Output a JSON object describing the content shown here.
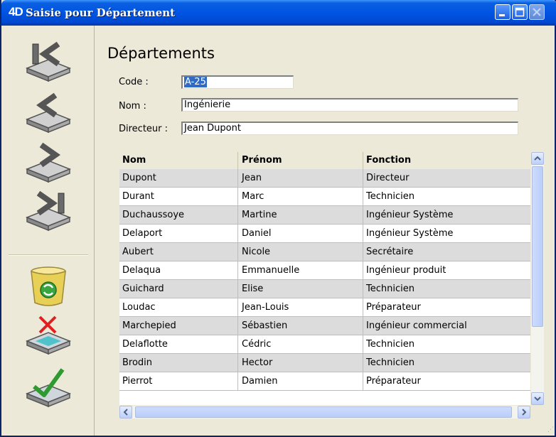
{
  "window": {
    "logo": "4D",
    "title": "Saisie pour  Département"
  },
  "toolbar": {
    "first_icon": "first-record-icon",
    "previous_icon": "previous-record-icon",
    "next_icon": "next-record-icon",
    "last_icon": "last-record-icon",
    "delete_icon": "delete-record-icon",
    "cancel_icon": "cancel-icon",
    "validate_icon": "validate-icon"
  },
  "form": {
    "heading": "Départements",
    "code_label": "Code :",
    "code_value": "A-25",
    "nom_label": "Nom :",
    "nom_value": "Ingénierie",
    "directeur_label": "Directeur :",
    "directeur_value": "Jean Dupont"
  },
  "table": {
    "columns": [
      "Nom",
      "Prénom",
      "Fonction"
    ],
    "rows": [
      [
        "Dupont",
        "Jean",
        "Directeur"
      ],
      [
        "Durant",
        "Marc",
        "Technicien"
      ],
      [
        "Duchaussoye",
        "Martine",
        "Ingénieur Système"
      ],
      [
        "Delaport",
        "Daniel",
        "Ingénieur Système"
      ],
      [
        "Aubert",
        "Nicole",
        "Secrétaire"
      ],
      [
        "Delaqua",
        "Emmanuelle",
        "Ingénieur produit"
      ],
      [
        "Guichard",
        "Elise",
        "Technicien"
      ],
      [
        "Loudac",
        "Jean-Louis",
        "Préparateur"
      ],
      [
        "Marchepied",
        "Sébastien",
        "Ingénieur commercial"
      ],
      [
        "Delaflotte",
        "Cédric",
        "Technicien"
      ],
      [
        "Brodin",
        "Hector",
        "Technicien"
      ],
      [
        "Pierrot",
        "Damien",
        "Préparateur"
      ]
    ]
  },
  "colors": {
    "titlebar": "#0054e3",
    "selection": "#316ac5",
    "row_alt": "#dcdcdc",
    "window_bg": "#ece9d8"
  }
}
